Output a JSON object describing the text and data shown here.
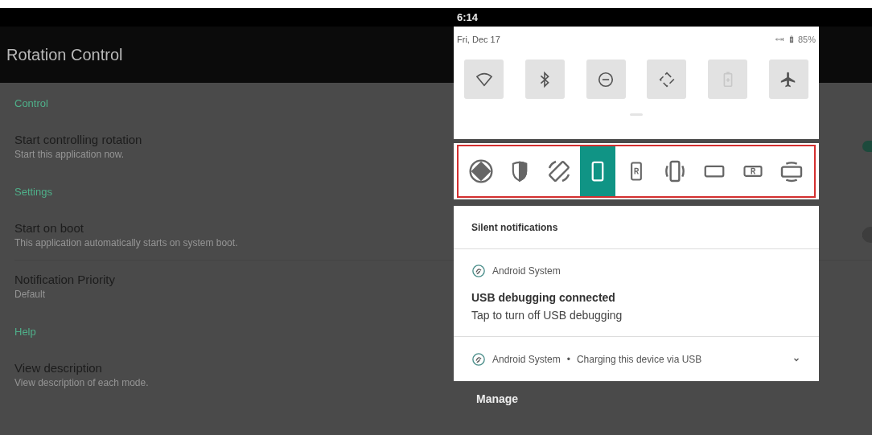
{
  "app": {
    "title": "Rotation Control",
    "sections": [
      {
        "header": "Control",
        "items": [
          {
            "kind": "switch",
            "title": "Start controlling rotation",
            "summary": "Start this application now.",
            "on": true
          }
        ]
      },
      {
        "header": "Settings",
        "items": [
          {
            "kind": "switch",
            "title": "Start on boot",
            "summary": "This application automatically starts on system boot.",
            "on": false
          },
          {
            "kind": "plain",
            "title": "Notification Priority",
            "summary": "Default"
          }
        ]
      },
      {
        "header": "Help",
        "items": [
          {
            "kind": "plain",
            "title": "View description",
            "summary": "View description of each mode."
          }
        ]
      }
    ]
  },
  "status_bar": {
    "time": "6:14"
  },
  "quick_settings": {
    "date": "Fri, Dec 17",
    "battery": "85%",
    "tiles": [
      {
        "disabled": false
      },
      {
        "disabled": false
      },
      {
        "disabled": false
      },
      {
        "disabled": false
      },
      {
        "disabled": true
      },
      {
        "disabled": false
      }
    ]
  },
  "rotation_modes": [
    {
      "selected": false
    },
    {
      "selected": false
    },
    {
      "selected": false
    },
    {
      "selected": true
    },
    {
      "selected": false
    },
    {
      "selected": false
    },
    {
      "selected": false
    },
    {
      "selected": false
    },
    {
      "selected": false
    }
  ],
  "notifications": {
    "header": "Silent notifications",
    "items": [
      {
        "kind": "expanded",
        "app": "Android System",
        "title": "USB debugging connected",
        "text": "Tap to turn off USB debugging"
      },
      {
        "kind": "collapsed",
        "app": "Android System",
        "separator": "•",
        "text": "Charging this device via USB"
      }
    ],
    "manage": "Manage"
  }
}
